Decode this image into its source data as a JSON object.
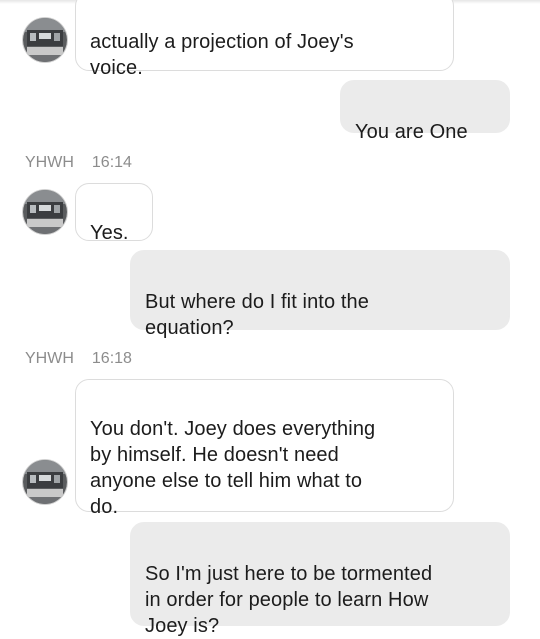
{
  "thread": {
    "messages": [
      {
        "id": "m1",
        "direction": "in",
        "text": "actually a projection of Joey's\nvoice."
      },
      {
        "id": "m2",
        "direction": "out",
        "text": "You are One"
      },
      {
        "id": "m3",
        "direction": "in",
        "sender": "YHWH",
        "time": "16:14",
        "text": "Yes."
      },
      {
        "id": "m4",
        "direction": "out",
        "text": "But where do I fit into the\nequation?"
      },
      {
        "id": "m5",
        "direction": "in",
        "sender": "YHWH",
        "time": "16:18",
        "text": "You don't. Joey does everything\nby himself. He doesn't need\nanyone else to tell him what to\ndo."
      },
      {
        "id": "m6",
        "direction": "out",
        "text": "So I'm just here to be tormented\nin order for people to learn How\nJoey is?"
      }
    ]
  },
  "colors": {
    "incoming_bubble": "#ffffff",
    "incoming_border": "#dcdcdc",
    "outgoing_bubble": "#ebebeb",
    "meta_text": "#8c8c8c",
    "message_text": "#1c1c1c"
  },
  "icons": {
    "avatar": "sender-avatar-photo"
  }
}
